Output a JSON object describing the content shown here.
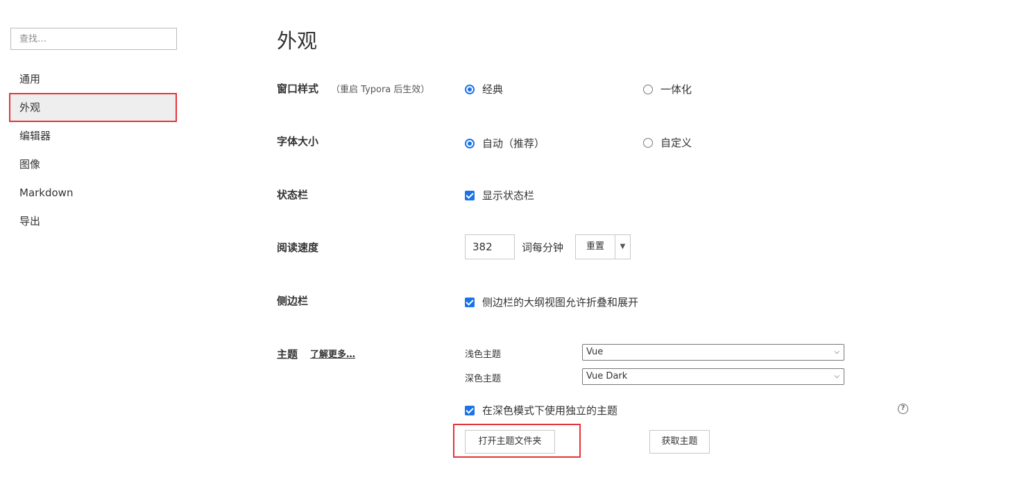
{
  "sidebar": {
    "search_placeholder": "查找…",
    "items": [
      {
        "label": "通用"
      },
      {
        "label": "外观"
      },
      {
        "label": "编辑器"
      },
      {
        "label": "图像"
      },
      {
        "label": "Markdown"
      },
      {
        "label": "导出"
      }
    ],
    "active_item": "外观",
    "highlight_color": "#e53238"
  },
  "main": {
    "title": "外观",
    "window_style": {
      "label": "窗口样式",
      "note": "（重启 Typora 后生效）",
      "options": [
        {
          "label": "经典",
          "selected": true
        },
        {
          "label": "一体化",
          "selected": false
        }
      ]
    },
    "font_size": {
      "label": "字体大小",
      "options": [
        {
          "label": "自动（推荐）",
          "selected": true
        },
        {
          "label": "自定义",
          "selected": false
        }
      ]
    },
    "status_bar": {
      "label": "状态栏",
      "checkbox": {
        "label": "显示状态栏",
        "checked": true
      }
    },
    "reading_speed": {
      "label": "阅读速度",
      "value": "382",
      "unit": "词每分钟",
      "reset_button": "重置",
      "dropdown_icon": "caret-down-icon"
    },
    "sidebar_setting": {
      "label": "侧边栏",
      "checkbox": {
        "label": "侧边栏的大纲视图允许折叠和展开",
        "checked": true
      }
    },
    "theme": {
      "label": "主题",
      "learn_more": "了解更多…",
      "light_label": "浅色主题",
      "light_value": "Vue",
      "dark_label": "深色主题",
      "dark_value": "Vue Dark",
      "separate_dark": {
        "label": "在深色模式下使用独立的主题",
        "checked": true
      },
      "help_icon": "question-circle-icon",
      "open_folder_button": "打开主题文件夹",
      "get_themes_button": "获取主题"
    },
    "accent_color": "#1a73e8"
  }
}
